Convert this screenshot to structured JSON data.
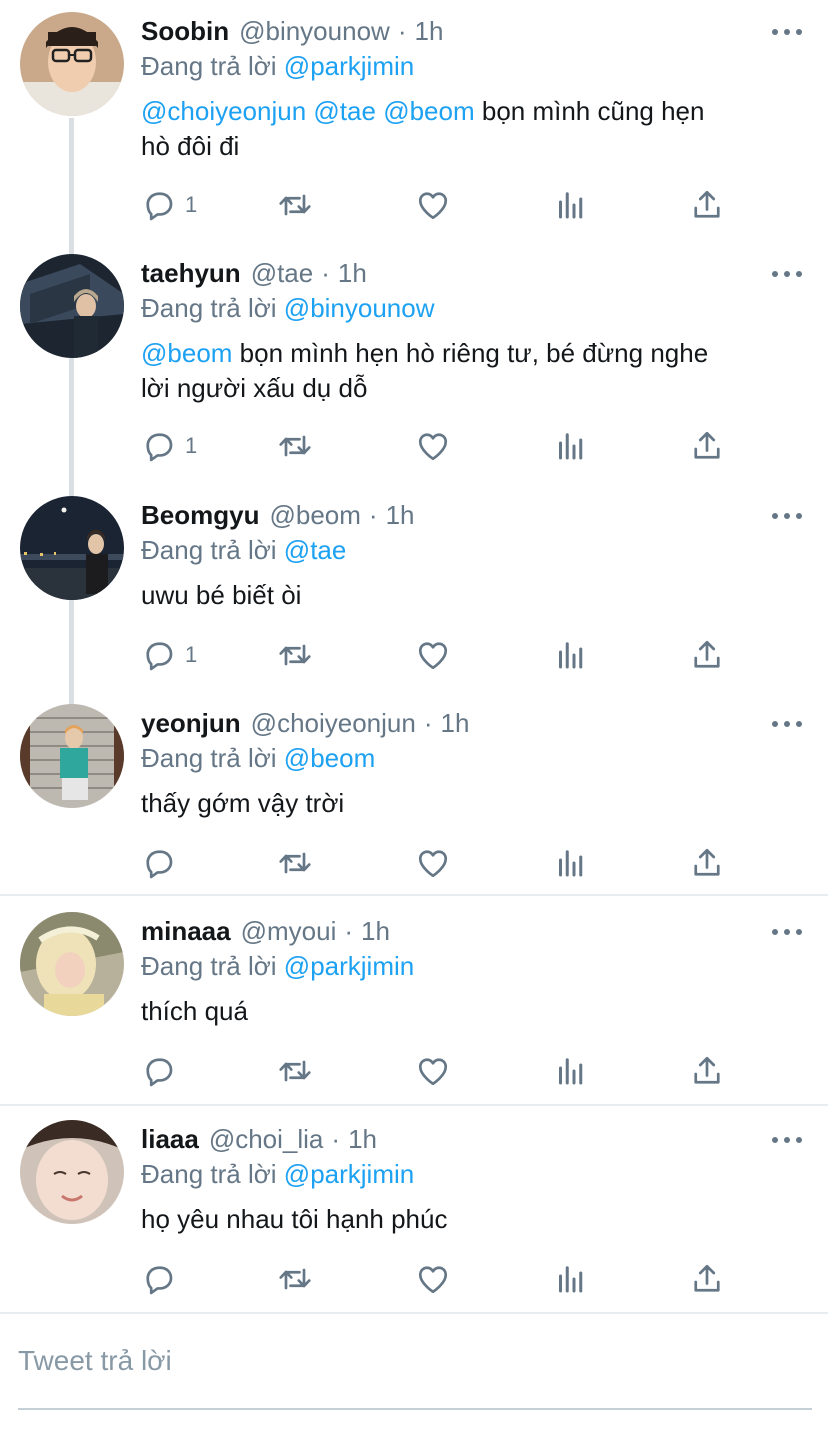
{
  "tweets": [
    {
      "name": "Soobin",
      "handle": "@binyounow",
      "sep": "·",
      "time": "1h",
      "reply_prefix": "Đang trả lời",
      "reply_to": "@parkjimin",
      "mentions": [
        "@choiyeonjun",
        "@tae",
        "@beom"
      ],
      "text_line1": "bọn mình cũng hẹn",
      "text_line2": "hò đôi đi",
      "reply_count": "1"
    },
    {
      "name": "taehyun",
      "handle": "@tae",
      "sep": "·",
      "time": "1h",
      "reply_prefix": "Đang trả lời",
      "reply_to": "@binyounow",
      "mention": "@beom",
      "text_line1": "bọn mình hẹn hò riêng tư, bé đừng nghe",
      "text_line2": "lời người xấu dụ dỗ",
      "reply_count": "1"
    },
    {
      "name": "Beomgyu",
      "handle": "@beom",
      "sep": "·",
      "time": "1h",
      "reply_prefix": "Đang trả lời",
      "reply_to": "@tae",
      "text": "uwu bé biết òi",
      "reply_count": "1"
    },
    {
      "name": "yeonjun",
      "handle": "@choiyeonjun",
      "sep": "·",
      "time": "1h",
      "reply_prefix": "Đang trả lời",
      "reply_to": "@beom",
      "text": "thấy gớm vậy trời",
      "reply_count": ""
    },
    {
      "name": "minaaa",
      "handle": "@myoui",
      "sep": "·",
      "time": "1h",
      "reply_prefix": "Đang trả lời",
      "reply_to": "@parkjimin",
      "text": "thích quá",
      "reply_count": ""
    },
    {
      "name": "liaaa",
      "handle": "@choi_lia",
      "sep": "·",
      "time": "1h",
      "reply_prefix": "Đang trả lời",
      "reply_to": "@parkjimin",
      "text": "họ yêu nhau tôi hạnh phúc",
      "reply_count": ""
    }
  ],
  "icons": {
    "reply": "reply-icon",
    "retweet": "retweet-icon",
    "like": "heart-icon",
    "analytics": "analytics-icon",
    "share": "share-icon",
    "more": "more-icon"
  },
  "colors": {
    "link": "#1da1f2",
    "secondary": "#657786",
    "thread_line": "#dadfe3",
    "divider": "#e6ecf0"
  },
  "compose": {
    "placeholder": "Tweet trả lời"
  }
}
